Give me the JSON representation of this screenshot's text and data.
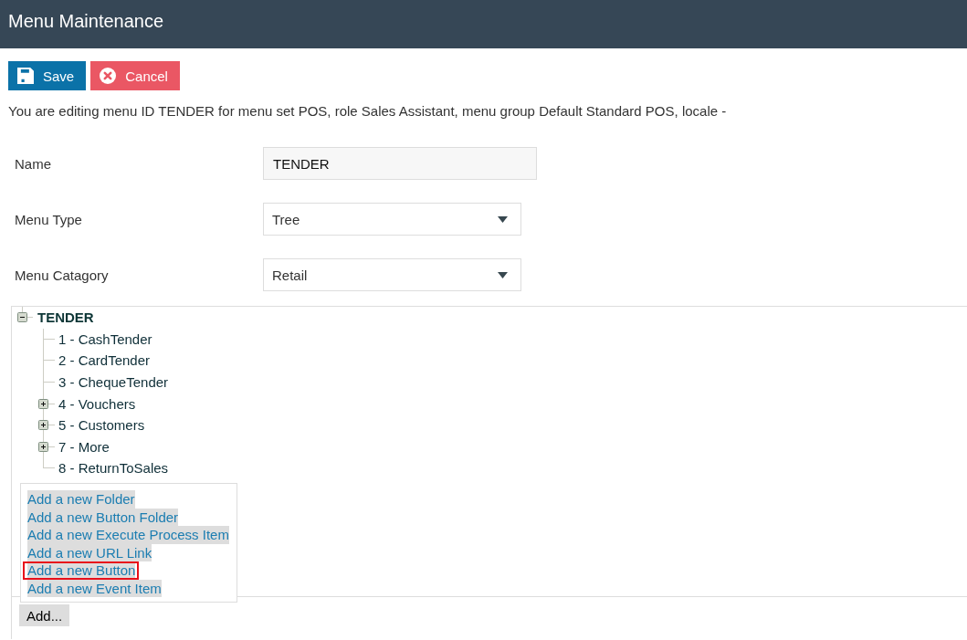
{
  "header": {
    "title": "Menu Maintenance"
  },
  "toolbar": {
    "buttons": [
      {
        "kind": "save",
        "label": "Save"
      },
      {
        "kind": "cancel",
        "label": "Cancel"
      }
    ]
  },
  "info_text": "You are editing menu ID TENDER for menu set POS, role Sales Assistant, menu group Default Standard POS, locale -",
  "form": {
    "fields": [
      {
        "kind": "text",
        "label": "Name",
        "value": "TENDER",
        "readonly": true
      },
      {
        "kind": "select",
        "label": "Menu Type",
        "value": "Tree",
        "readonly": false
      },
      {
        "kind": "select",
        "label": "Menu Catagory",
        "value": "Retail",
        "readonly": false
      }
    ]
  },
  "tree": {
    "root": {
      "label": "TENDER",
      "kind": "folder",
      "expanded": true,
      "children": [
        {
          "label": "1 - CashTender",
          "kind": "item"
        },
        {
          "label": "2 - CardTender",
          "kind": "item"
        },
        {
          "label": "3 - ChequeTender",
          "kind": "item"
        },
        {
          "label": "4 - Vouchers",
          "kind": "folder",
          "expanded": false
        },
        {
          "label": "5 - Customers",
          "kind": "folder",
          "expanded": false
        },
        {
          "label": "7 - More",
          "kind": "folder",
          "expanded": false
        },
        {
          "label": "8 - ReturnToSales",
          "kind": "item"
        }
      ]
    }
  },
  "add_menu": {
    "items": [
      {
        "label": "Add a new Folder",
        "selected": false
      },
      {
        "label": "Add a new Button Folder",
        "selected": false
      },
      {
        "label": "Add a new Execute Process Item",
        "selected": false
      },
      {
        "label": "Add a new URL Link",
        "selected": false
      },
      {
        "label": "Add a new Button",
        "selected": true
      },
      {
        "label": "Add a new Event Item",
        "selected": false
      }
    ]
  },
  "add_button": {
    "label": "Add..."
  }
}
